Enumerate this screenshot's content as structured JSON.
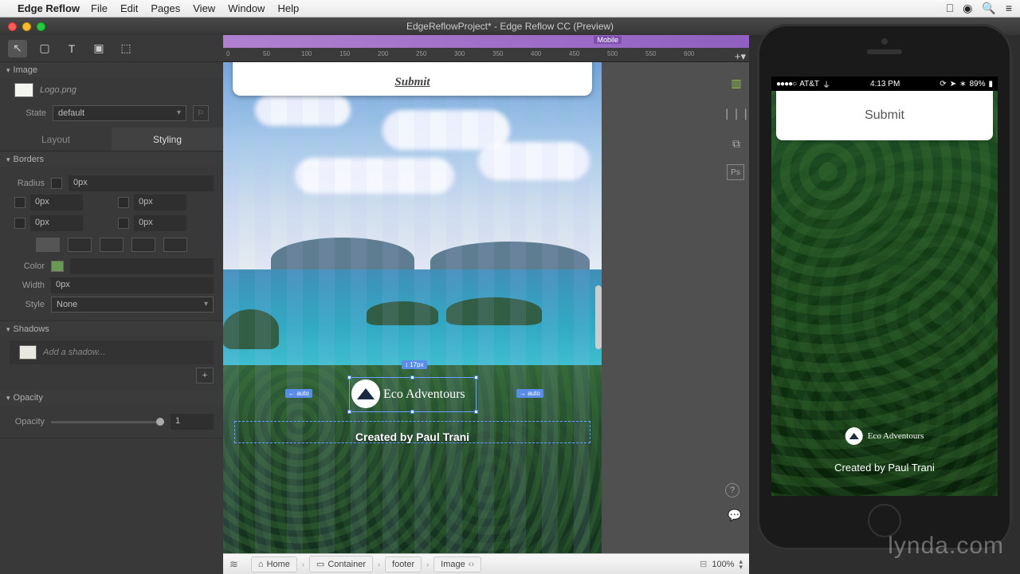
{
  "menubar": {
    "app": "Edge Reflow",
    "items": [
      "File",
      "Edit",
      "Pages",
      "View",
      "Window",
      "Help"
    ]
  },
  "window": {
    "title": "EdgeReflowProject* - Edge Reflow CC (Preview)"
  },
  "inspector": {
    "section": "Image",
    "asset_name": "Logo.png",
    "state_label": "State",
    "state_value": "default",
    "tabs": {
      "layout": "Layout",
      "styling": "Styling"
    },
    "borders": {
      "title": "Borders",
      "radius_label": "Radius",
      "radius_tl": "0px",
      "radius_tr": "0px",
      "radius_bl": "0px",
      "radius_br": "0px",
      "radius_all": "0px",
      "color_label": "Color",
      "width_label": "Width",
      "width_value": "0px",
      "style_label": "Style",
      "style_value": "None"
    },
    "shadows": {
      "title": "Shadows",
      "placeholder": "Add a shadow...",
      "plus": "+"
    },
    "opacity": {
      "title": "Opacity",
      "label": "Opacity",
      "value": "1"
    }
  },
  "breakpoint": {
    "label": "Mobile"
  },
  "ruler": [
    "0",
    "50",
    "100",
    "150",
    "200",
    "250",
    "300",
    "350",
    "400",
    "450",
    "500",
    "550",
    "600"
  ],
  "canvas": {
    "submit": "Submit",
    "brand": "Eco Adventours",
    "credit": "Created by Paul Trani",
    "anno_top": "↕ 17px",
    "anno_left": "← auto",
    "anno_right": "→ auto"
  },
  "phone": {
    "carrier": "AT&T",
    "time": "4:13 PM",
    "battery": "89%",
    "submit": "Submit",
    "brand": "Eco Adventours",
    "credit": "Created by Paul Trani"
  },
  "breadcrumb": {
    "items": [
      "Home",
      "Container",
      "footer",
      "Image"
    ],
    "zoom": "100%"
  },
  "watermark": "lynda.com"
}
